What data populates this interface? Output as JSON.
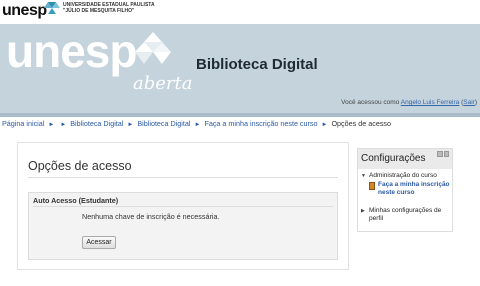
{
  "top": {
    "logo_text": "unesp",
    "university_line1": "UNIVERSIDADE ESTADUAL PAULISTA",
    "university_line2": "\"JÚLIO DE MESQUITA FILHO\""
  },
  "banner": {
    "logo_text": "unesp",
    "logo_sub": "aberta",
    "site_title": "Biblioteca Digital",
    "login_prefix": "Você acessou como ",
    "user_name": "Angelo Luis Ferreira",
    "logout_label": "Sair",
    "brand_color": "#c4d3dc"
  },
  "breadcrumb": {
    "items": [
      "Página inicial",
      "Biblioteca Digital",
      "Biblioteca Digital",
      "Faça a minha inscrição neste curso"
    ],
    "current": "Opções de acesso"
  },
  "main": {
    "heading": "Opções de acesso",
    "panel_title": "Auto Acesso (Estudante)",
    "message": "Nenhuma chave de inscrição é necessária.",
    "submit_label": "Acessar"
  },
  "sidebar": {
    "block_title": "Configurações",
    "admin_label": "Administração do curso",
    "enrol_link": "Faça a minha inscrição neste curso",
    "profile_label": "Minhas configurações de perfil"
  }
}
